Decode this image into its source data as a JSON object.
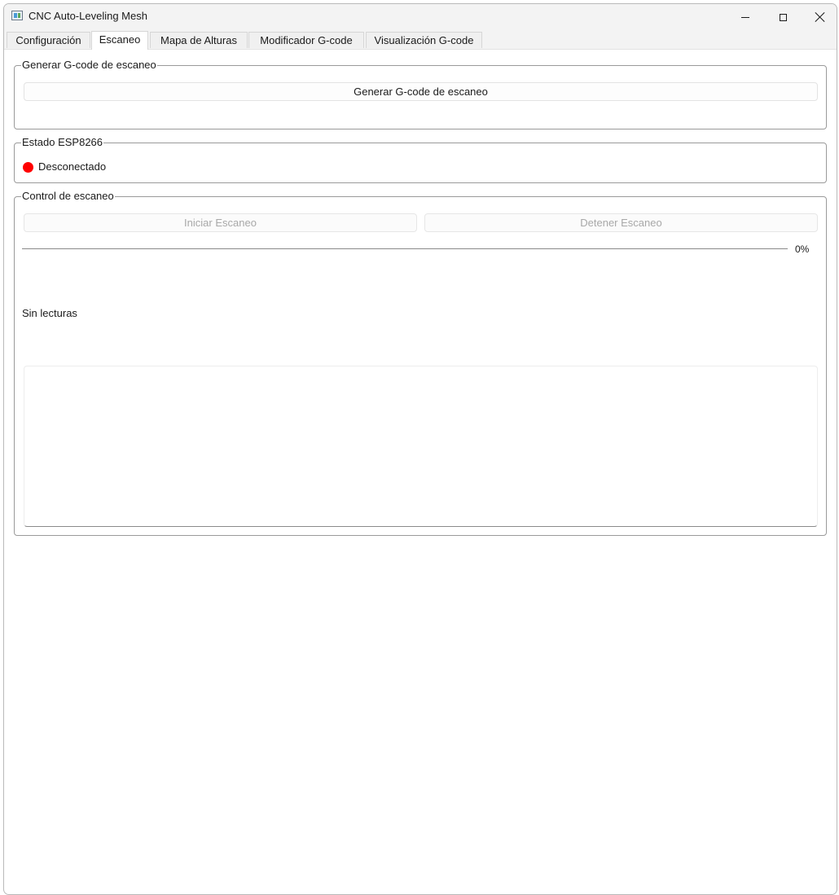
{
  "window": {
    "title": "CNC Auto-Leveling Mesh"
  },
  "tabs": [
    {
      "label": "Configuración",
      "active": false
    },
    {
      "label": "Escaneo",
      "active": true
    },
    {
      "label": "Mapa de Alturas",
      "active": false
    },
    {
      "label": "Modificador G-code",
      "active": false
    },
    {
      "label": "Visualización G-code",
      "active": false
    }
  ],
  "generate_group": {
    "title": "Generar G-code de escaneo",
    "button_label": "Generar G-code de escaneo"
  },
  "status_group": {
    "title": "Estado ESP8266",
    "status_text": "Desconectado",
    "status_color": "#ff0000"
  },
  "scan_group": {
    "title": "Control de escaneo",
    "start_label": "Iniciar Escaneo",
    "start_enabled": false,
    "stop_label": "Detener Escaneo",
    "stop_enabled": false,
    "progress_value": 0,
    "progress_label": "0%",
    "readings_text": "Sin lecturas",
    "log_text": ""
  }
}
